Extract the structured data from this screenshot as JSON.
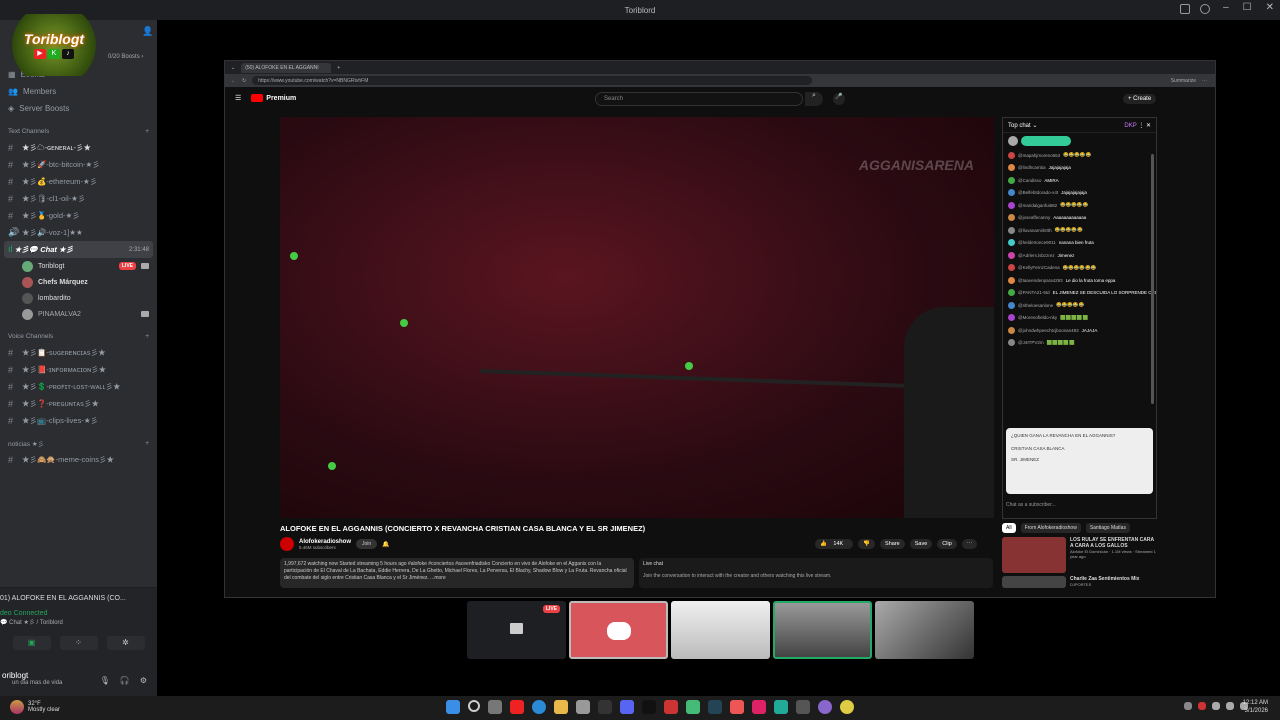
{
  "window": {
    "title": "Toriblord"
  },
  "server": {
    "logo_text": "Toriblogt",
    "boosts": "0/20 Boosts ›",
    "nav": [
      {
        "label": "Events"
      },
      {
        "label": "Members"
      },
      {
        "label": "Server Boosts"
      }
    ],
    "text_category": "Text Channels",
    "text_channels": [
      "★彡☁-ɢᴇɴᴇʀᴀʟ-彡★",
      "★彡🚀-btc-bitcoin-★彡",
      "★彡💰-ethereum-★彡",
      "★彡🛢-cl1-oil-★彡",
      "★彡🥇-gold-★彡",
      "★彡🔊-voz-1]★★"
    ],
    "active_channel": {
      "label": "★彡💬 Chat ★彡",
      "time": "2:31:48"
    },
    "voice_users": [
      {
        "name": "Toriblogt",
        "live": "LIVE"
      },
      {
        "name": "Chefs Márquez"
      },
      {
        "name": "lombardito"
      },
      {
        "name": "PINAMALVA2"
      }
    ],
    "voice_category": "Voice Channels",
    "voice_channels": [
      "★彡📋-ꜱᴜɢᴇʀᴇɴᴄɪᴀꜱ彡★",
      "★彡📕-ɪɴꜰᴏʀᴍᴀᴄɪᴏɴ彡★",
      "★彡💲-ᴘʀᴏꜰɪᴛ-ʟᴏꜱᴛ-ᴡᴀʟʟ彡★",
      "★彡❓-ᴘʀᴇɢᴜɴᴛᴀꜱ彡★",
      "★彡📺-clips-lives-★彡"
    ],
    "news_category": "noticias ★彡",
    "news_channels": [
      "★彡🙈🙊-meme-coins彡★"
    ]
  },
  "voice_panel": {
    "title": "01) ALOFOKE EN EL AGGANNIS (CO...",
    "status": "deo Connected",
    "sub": "💬 Chat ★彡 / Toriblord"
  },
  "user": {
    "name": "oriblogt",
    "status": "un dia mas de vida"
  },
  "browser": {
    "tab": "(50) ALOFOKE EN EL AGGANNI",
    "url": "https://www.youtube.com/watch?v=NBNGRtvhFM",
    "summarize": "Summarize"
  },
  "youtube": {
    "brand": "Premium",
    "search_placeholder": "Search",
    "create": "+ Create",
    "watermark": "AGGANISARENA",
    "video_title": "ALOFOKE EN EL AGGANNIS (CONCIERTO X REVANCHA CRISTIAN CASA BLANCA Y EL SR JIMENEZ)",
    "channel": "Alofokeradioshow",
    "subs": "5.46M subscribers",
    "join": "Join",
    "likes": "14K",
    "share": "Share",
    "save": "Save",
    "clip": "Clip",
    "description": "1,997,672 watching now  Started streaming 5 hours ago  #alofoke #conciertos #aceenfriadisko  Concierto en vivo de Alofoke en el Agganis con la participación de El Chaval de La Bachata, Eddie Herrera, De La Ghetto, Michael Flores, La Perversa, El Blachy, Shadow Blow y La Fruta. Revancha oficial del combate del siglo entre Cristian Casa Blanca y el Sr Jiménez. ...more",
    "live_chat_title": "Live chat",
    "live_chat_text": "Join the conversation to interact with the creator and others watching this live stream."
  },
  "chat": {
    "title": "Top chat ⌄",
    "dkp": "DKP",
    "messages": [
      {
        "user": "@mapahjmoreno653",
        "text": "😂😂😂😂😂"
      },
      {
        "user": "@lindhcamba",
        "text": "Jajajajajaja"
      },
      {
        "user": "@Candisso",
        "text": "AMIRA"
      },
      {
        "user": "@Belfebtdorado-x4t",
        "text": "Jajajajajajaja"
      },
      {
        "user": "@maridalganfui682",
        "text": "😂😂😂😂😂"
      },
      {
        "user": "@joseaffecanny",
        "text": "Aaaaaaaaaaaaa"
      },
      {
        "user": "@lluvanamirk0th",
        "text": "😂😂😂😂😂"
      },
      {
        "user": "@heldertonce9011",
        "text": "nanana bien fruta"
      },
      {
        "user": "@Adrlers.lsbzzrez",
        "text": "Jimenez"
      },
      {
        "user": "@KellyFernzCadena",
        "text": "😂😂😂😂😂😂"
      },
      {
        "user": "@taavendenpara4293",
        "text": "Le dio la fruta toma eppa"
      },
      {
        "user": "@PANTA21-5td",
        "text": "EL JIMENEZ SE DESCUIDA LO SORPRENDE CRISTIAN"
      },
      {
        "user": "@ritheloesanlone",
        "text": "😂😂😂😂😂"
      },
      {
        "user": "@Morenofieldo-nky",
        "text": "🟩🟩🟩🟩🟩"
      },
      {
        "user": "@johndwhpeechtcjboonan483",
        "text": "JAJAJA"
      },
      {
        "user": "@J4ITPV2m",
        "text": "🟩🟩🟩🟩🟩"
      }
    ],
    "poll": {
      "question": "¿QUIEN GANA LA REVANCHA EN EL AGGANNIS?",
      "option1": "CRISTIAN CASA BLANCA",
      "option2": "SR. JIMENEZ"
    },
    "input_placeholder": "Chat as a subscriber..."
  },
  "recommendations": {
    "tabs": [
      "All",
      "From Alofokeradioshow",
      "Santiago Matías"
    ],
    "items": [
      {
        "title": "LOS RULAY SE ENFRENTAN CARA A CARA A LOS GALLOS",
        "meta": "Alofoke El Dominicán · 1.1M views · Streamed 1 year ago"
      },
      {
        "title": "Charlie Zaa Sentimientos Mix",
        "meta": "DJPORTES"
      }
    ]
  },
  "streams": {
    "live": "LIVE"
  },
  "taskbar": {
    "temp": "32°F",
    "weather": "Mostly clear",
    "time": "12:12 AM",
    "date": "3/1/2026"
  }
}
